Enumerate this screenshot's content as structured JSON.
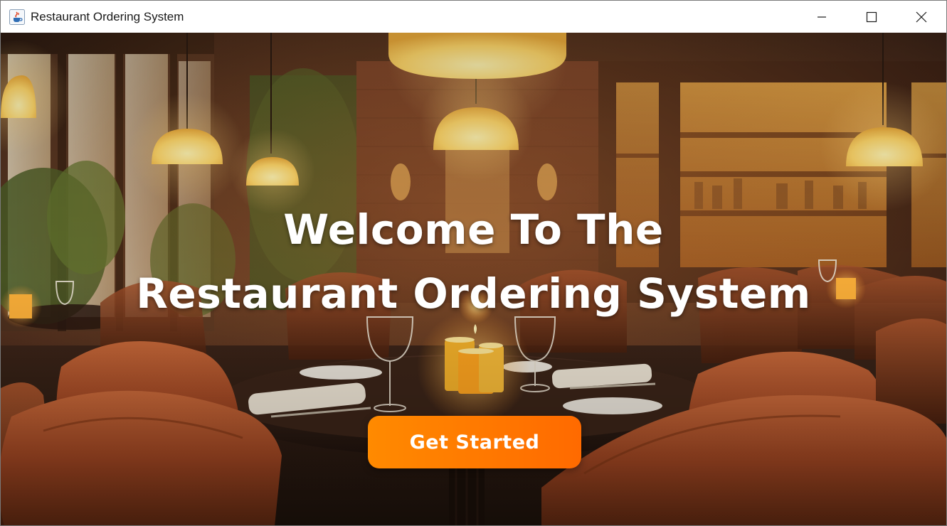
{
  "window": {
    "title": "Restaurant Ordering System",
    "icon": "java-cup-icon",
    "controls": [
      "minimize",
      "maximize",
      "close"
    ]
  },
  "hero": {
    "heading_line1": "Welcome To The",
    "heading_line2": "Restaurant Ordering System",
    "background": "restaurant-interior-photo"
  },
  "cta": {
    "label": "Get Started",
    "color_start": "#ff8a00",
    "color_end": "#ff6a00"
  }
}
